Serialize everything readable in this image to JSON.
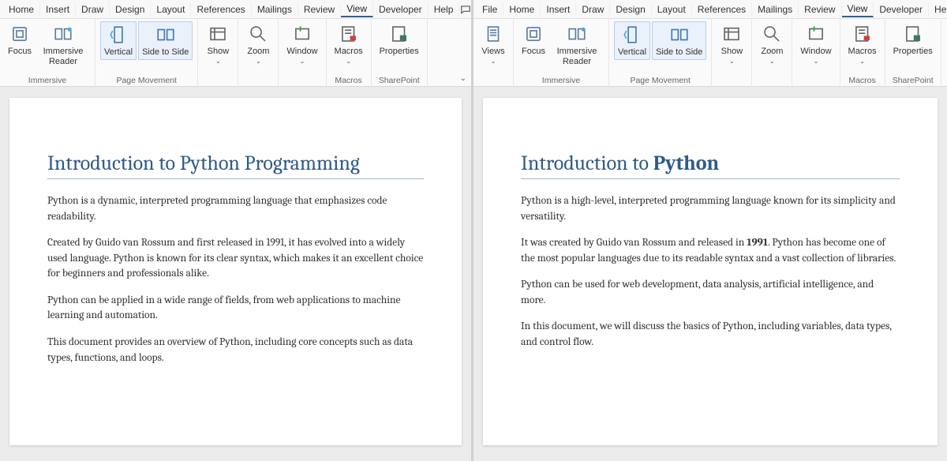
{
  "colors": {
    "accent": "#2e5a8a",
    "ribbon_bg": "#fafafa",
    "tab_underline": "#305e9e",
    "highlight_btn": "#3a7bd5"
  },
  "left": {
    "tabs": [
      "Home",
      "Insert",
      "Draw",
      "Design",
      "Layout",
      "References",
      "Mailings",
      "Review",
      "View",
      "Developer",
      "Help"
    ],
    "active_tab": "View",
    "titlebar_icons": [
      "comment-icon",
      "pencil-icon",
      "share-icon"
    ],
    "ribbon": {
      "immersive": {
        "label": "Immersive",
        "focus": "Focus",
        "reader": "Immersive Reader"
      },
      "page_movement": {
        "label": "Page Movement",
        "vertical": "Vertical",
        "side": "Side to Side"
      },
      "show": {
        "label": "Show"
      },
      "zoom": {
        "label": "Zoom"
      },
      "window": {
        "label": "Window"
      },
      "macros": {
        "group": "Macros",
        "label": "Macros"
      },
      "sharepoint": {
        "group": "SharePoint",
        "label": "Properties"
      }
    },
    "doc": {
      "title": "Introduction to Python Programming",
      "p1": "Python is a dynamic, interpreted programming language that emphasizes code readability.",
      "p2": "Created by Guido van Rossum and first released in 1991, it has evolved into a widely used language. Python is known for its clear syntax, which makes it an excellent choice for beginners and professionals alike.",
      "p3": "Python can be applied in a wide range of fields, from web applications to machine learning and automation.",
      "p4": "This document provides an overview of Python, including core concepts such as data types, functions, and loops."
    }
  },
  "right": {
    "tabs": [
      "File",
      "Home",
      "Insert",
      "Draw",
      "Design",
      "Layout",
      "References",
      "Mailings",
      "Review",
      "View",
      "Developer",
      "Help"
    ],
    "active_tab": "View",
    "titlebar_icons": [
      "comment-icon",
      "pencil-icon"
    ],
    "ribbon": {
      "views": {
        "group": "",
        "label": "Views"
      },
      "immersive": {
        "label": "Immersive",
        "focus": "Focus",
        "reader": "Immersive Reader"
      },
      "page_movement": {
        "label": "Page Movement",
        "vertical": "Vertical",
        "side": "Side to Side"
      },
      "show": {
        "label": "Show"
      },
      "zoom": {
        "label": "Zoom"
      },
      "window": {
        "label": "Window"
      },
      "macros": {
        "group": "Macros",
        "label": "Macros"
      },
      "sharepoint": {
        "group": "SharePoint",
        "label": "Properties"
      }
    },
    "doc": {
      "title_a": "Introduction to ",
      "title_b": "Python",
      "p1": "Python is a high-level, interpreted programming language known for its simplicity and versatility.",
      "p2a": "It was created by Guido van Rossum and released in ",
      "p2b": "1991",
      "p2c": ". Python has become one of the most popular languages due to its readable syntax and a vast collection of libraries.",
      "p3": "Python can be used for web development, data analysis, artificial intelligence, and more.",
      "p4": "In this document, we will discuss the basics of Python, including variables, data types, and control flow."
    }
  }
}
